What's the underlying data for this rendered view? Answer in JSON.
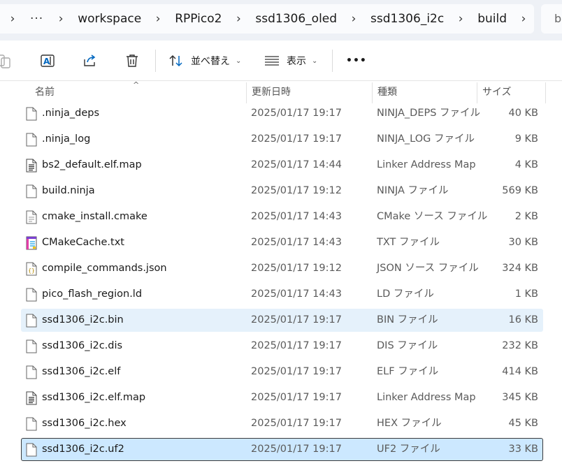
{
  "breadcrumb": {
    "more": "···",
    "items": [
      "workspace",
      "RPPico2",
      "ssd1306_oled",
      "ssd1306_i2c",
      "build"
    ],
    "sep": "›"
  },
  "search": {
    "partial_text": "b"
  },
  "toolbar": {
    "sort_label": "並べ替え",
    "view_label": "表示",
    "more_label": "•••"
  },
  "columns": {
    "name": "名前",
    "date": "更新日時",
    "type": "種類",
    "size": "サイズ"
  },
  "files": [
    {
      "name": ".ninja_deps",
      "date": "2025/01/17 19:17",
      "type": "NINJA_DEPS ファイル",
      "size": "40 KB",
      "icon": "file-icon"
    },
    {
      "name": ".ninja_log",
      "date": "2025/01/17 19:17",
      "type": "NINJA_LOG ファイル",
      "size": "9 KB",
      "icon": "file-icon"
    },
    {
      "name": "bs2_default.elf.map",
      "date": "2025/01/17 14:44",
      "type": "Linker Address Map",
      "size": "4 KB",
      "icon": "text-file-icon"
    },
    {
      "name": "build.ninja",
      "date": "2025/01/17 19:12",
      "type": "NINJA ファイル",
      "size": "569 KB",
      "icon": "file-icon"
    },
    {
      "name": "cmake_install.cmake",
      "date": "2025/01/17 14:43",
      "type": "CMake ソース ファイル",
      "size": "2 KB",
      "icon": "source-file-icon"
    },
    {
      "name": "CMakeCache.txt",
      "date": "2025/01/17 14:43",
      "type": "TXT ファイル",
      "size": "30 KB",
      "icon": "txt-file-icon"
    },
    {
      "name": "compile_commands.json",
      "date": "2025/01/17 19:12",
      "type": "JSON ソース ファイル",
      "size": "324 KB",
      "icon": "json-file-icon"
    },
    {
      "name": "pico_flash_region.ld",
      "date": "2025/01/17 14:43",
      "type": "LD ファイル",
      "size": "1 KB",
      "icon": "file-icon"
    },
    {
      "name": "ssd1306_i2c.bin",
      "date": "2025/01/17 19:17",
      "type": "BIN ファイル",
      "size": "16 KB",
      "icon": "file-icon"
    },
    {
      "name": "ssd1306_i2c.dis",
      "date": "2025/01/17 19:17",
      "type": "DIS ファイル",
      "size": "232 KB",
      "icon": "file-icon"
    },
    {
      "name": "ssd1306_i2c.elf",
      "date": "2025/01/17 19:17",
      "type": "ELF ファイル",
      "size": "414 KB",
      "icon": "file-icon"
    },
    {
      "name": "ssd1306_i2c.elf.map",
      "date": "2025/01/17 19:17",
      "type": "Linker Address Map",
      "size": "345 KB",
      "icon": "text-file-icon"
    },
    {
      "name": "ssd1306_i2c.hex",
      "date": "2025/01/17 19:17",
      "type": "HEX ファイル",
      "size": "45 KB",
      "icon": "file-icon"
    },
    {
      "name": "ssd1306_i2c.uf2",
      "date": "2025/01/17 19:17",
      "type": "UF2 ファイル",
      "size": "33 KB",
      "icon": "file-icon"
    }
  ],
  "hover_row": 8,
  "selected_row": 13,
  "colors": {
    "hover": "#e5f1fb",
    "selected": "#cce8ff",
    "accent": "#0067c0"
  }
}
